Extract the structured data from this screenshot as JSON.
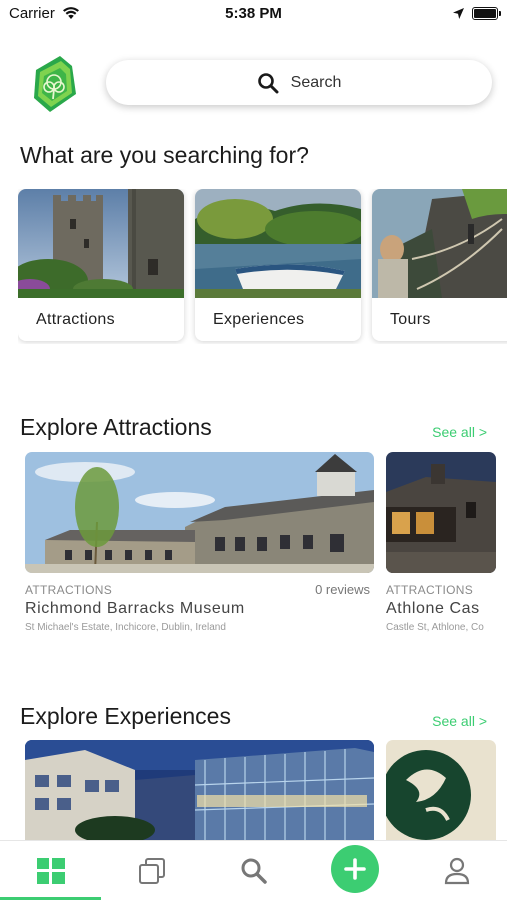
{
  "status_bar": {
    "carrier": "Carrier",
    "time": "5:38 PM"
  },
  "search": {
    "placeholder": "Search"
  },
  "categories_section": {
    "title": "What are you searching for?",
    "items": [
      {
        "label": "Attractions"
      },
      {
        "label": "Experiences"
      },
      {
        "label": "Tours"
      }
    ]
  },
  "attractions_section": {
    "title": "Explore Attractions",
    "see_all": "See all >",
    "items": [
      {
        "category": "ATTRACTIONS",
        "name": "Richmond Barracks Museum",
        "address": "St Michael's Estate, Inchicore, Dublin, Ireland",
        "reviews": "0 reviews"
      },
      {
        "category": "ATTRACTIONS",
        "name": "Athlone Cas",
        "address": "Castle St, Athlone, Co"
      }
    ]
  },
  "experiences_section": {
    "title": "Explore Experiences",
    "see_all": "See all >"
  },
  "tab_bar": {
    "tabs": [
      {
        "icon": "grid-icon"
      },
      {
        "icon": "collection-icon"
      },
      {
        "icon": "search-icon"
      },
      {
        "icon": "add-icon"
      },
      {
        "icon": "profile-icon"
      }
    ]
  },
  "colors": {
    "accent": "#3ccd72",
    "logo_green": "#2aa84a"
  }
}
